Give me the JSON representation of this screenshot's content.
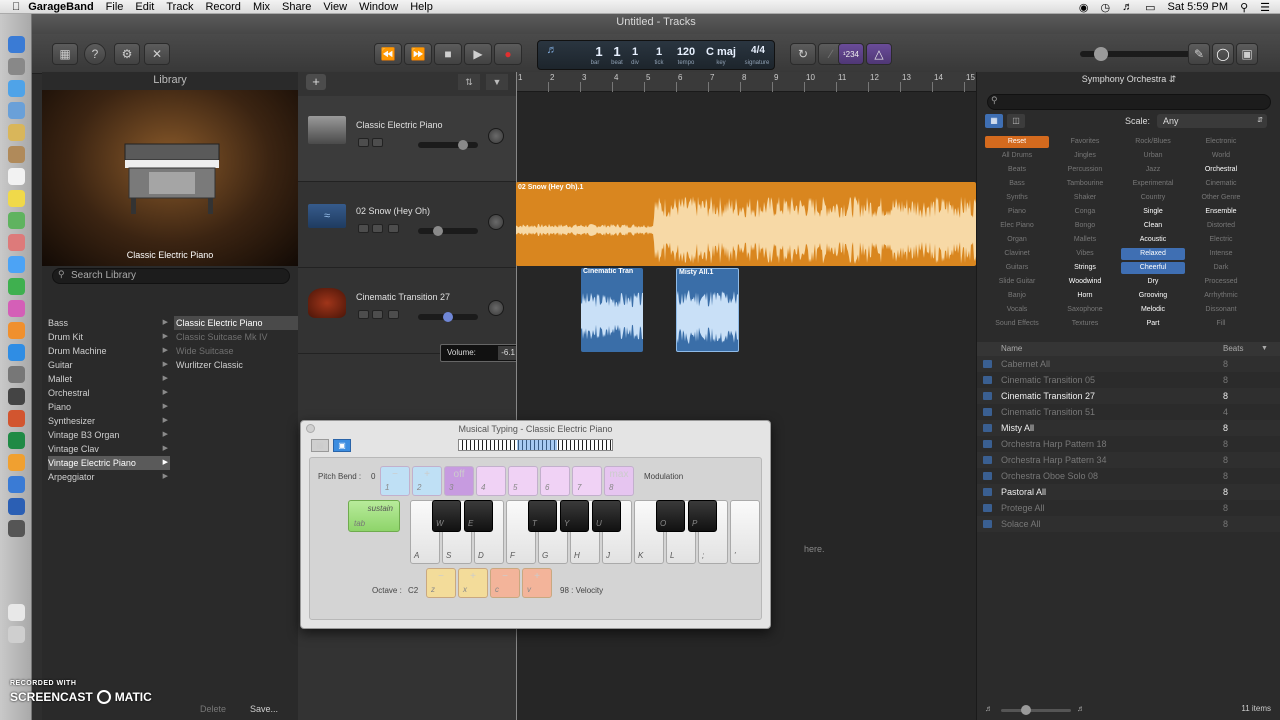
{
  "menubar": {
    "apple_icon": "apple-icon",
    "app_name": "GarageBand",
    "items": [
      "File",
      "Edit",
      "Track",
      "Record",
      "Mix",
      "Share",
      "View",
      "Window",
      "Help"
    ],
    "clock": "Sat 5:59 PM"
  },
  "window": {
    "title": "Untitled - Tracks"
  },
  "lcd": {
    "bar": "1",
    "beat": "1",
    "div": "1",
    "tick": "1",
    "tempo": "120",
    "key": "C maj",
    "signature": "4/4",
    "labels": {
      "bar": "bar",
      "beat": "beat",
      "div": "div",
      "tick": "tick",
      "tempo": "tempo",
      "key": "key",
      "signature": "signature"
    }
  },
  "toolbar": {
    "count_in": "¹234"
  },
  "library": {
    "title": "Library",
    "preview_caption": "Classic Electric Piano",
    "search_placeholder": "Search Library",
    "categories": [
      "Bass",
      "Drum Kit",
      "Drum Machine",
      "Guitar",
      "Mallet",
      "Orchestral",
      "Piano",
      "Synthesizer",
      "Vintage B3 Organ",
      "Vintage Clav",
      "Vintage Electric Piano",
      "Arpeggiator"
    ],
    "selected_category": "Vintage Electric Piano",
    "patches": [
      "Classic Electric Piano",
      "Classic Suitcase Mk IV",
      "Wide Suitcase",
      "Wurlitzer Classic"
    ],
    "delete_label": "Delete",
    "save_label": "Save..."
  },
  "tracks": [
    {
      "name": "Classic Electric Piano",
      "volume": 0.8
    },
    {
      "name": "02 Snow (Hey Oh)",
      "volume": 0.35
    },
    {
      "name": "Cinematic Transition 27",
      "volume": 0.5
    }
  ],
  "volume_tooltip": {
    "label": "Volume:",
    "value": "-6.1 dB"
  },
  "ruler": {
    "bars": [
      "1",
      "2",
      "3",
      "4",
      "5",
      "6",
      "7",
      "8",
      "9",
      "10",
      "11",
      "12",
      "13",
      "14",
      "15"
    ]
  },
  "regions": [
    {
      "title": "02 Snow (Hey Oh).1",
      "color": "#e59a2e"
    },
    {
      "title": "Cinematic Tran",
      "color": "#5c93c9"
    },
    {
      "title": "Misty All.1",
      "color": "#5c93c9"
    }
  ],
  "empty_hint_fragment": "here.",
  "loops": {
    "title": "Symphony Orchestra",
    "scale_label": "Scale:",
    "scale_value": "Any",
    "keywords": [
      [
        "Reset",
        "Favorites",
        "Rock/Blues",
        "Electronic"
      ],
      [
        "All Drums",
        "Jingles",
        "Urban",
        "World"
      ],
      [
        "Beats",
        "Percussion",
        "Jazz",
        "Orchestral"
      ],
      [
        "Bass",
        "Tambourine",
        "Experimental",
        "Cinematic"
      ],
      [
        "Synths",
        "Shaker",
        "Country",
        "Other Genre"
      ],
      [
        "Piano",
        "Conga",
        "Single",
        "Ensemble"
      ],
      [
        "Elec Piano",
        "Bongo",
        "Clean",
        "Distorted"
      ],
      [
        "Organ",
        "Mallets",
        "Acoustic",
        "Electric"
      ],
      [
        "Clavinet",
        "Vibes",
        "Relaxed",
        "Intense"
      ],
      [
        "Guitars",
        "Strings",
        "Cheerful",
        "Dark"
      ],
      [
        "Slide Guitar",
        "Woodwind",
        "Dry",
        "Processed"
      ],
      [
        "Banjo",
        "Horn",
        "Grooving",
        "Arrhythmic"
      ],
      [
        "Vocals",
        "Saxophone",
        "Melodic",
        "Dissonant"
      ],
      [
        "Sound Effects",
        "Textures",
        "Part",
        "Fill"
      ]
    ],
    "active_keywords": [
      "Orchestral",
      "Single",
      "Ensemble",
      "Clean",
      "Acoustic",
      "Strings",
      "Woodwind",
      "Dry",
      "Horn",
      "Grooving",
      "Melodic",
      "Part"
    ],
    "selected_keywords": [
      "Relaxed",
      "Cheerful"
    ],
    "columns": {
      "name": "Name",
      "beats": "Beats"
    },
    "results": [
      {
        "name": "Cabernet All",
        "beats": "8",
        "bright": false
      },
      {
        "name": "Cinematic Transition 05",
        "beats": "8",
        "bright": false
      },
      {
        "name": "Cinematic Transition 27",
        "beats": "8",
        "bright": true
      },
      {
        "name": "Cinematic Transition 51",
        "beats": "4",
        "bright": false
      },
      {
        "name": "Misty All",
        "beats": "8",
        "bright": true
      },
      {
        "name": "Orchestra Harp Pattern 18",
        "beats": "8",
        "bright": false
      },
      {
        "name": "Orchestra Harp Pattern 34",
        "beats": "8",
        "bright": false
      },
      {
        "name": "Orchestra Oboe Solo 08",
        "beats": "8",
        "bright": false
      },
      {
        "name": "Pastoral All",
        "beats": "8",
        "bright": true
      },
      {
        "name": "Protege All",
        "beats": "8",
        "bright": false
      },
      {
        "name": "Solace All",
        "beats": "8",
        "bright": false
      }
    ],
    "count": "11 items"
  },
  "musical_typing": {
    "title": "Musical Typing - Classic Electric Piano",
    "pitch_bend_label": "Pitch Bend :",
    "pitch_bend_value": "0",
    "modulation_label": "Modulation",
    "sustain_label": "sustain",
    "sustain_key": "tab",
    "pads": [
      {
        "top": "−",
        "key": "1"
      },
      {
        "top": "+",
        "key": "2"
      },
      {
        "top": "off",
        "key": "3"
      },
      {
        "top": "",
        "key": "4"
      },
      {
        "top": "",
        "key": "5"
      },
      {
        "top": "",
        "key": "6"
      },
      {
        "top": "",
        "key": "7"
      },
      {
        "top": "max",
        "key": "8"
      }
    ],
    "white_keys": [
      "A",
      "S",
      "D",
      "F",
      "G",
      "H",
      "J",
      "K",
      "L",
      ";",
      "'"
    ],
    "black_keys": [
      "W",
      "E",
      "T",
      "Y",
      "U",
      "O",
      "P"
    ],
    "octave_label": "Octave :",
    "octave_value": "C2",
    "octave_keys": [
      {
        "top": "−",
        "key": "z"
      },
      {
        "top": "+",
        "key": "x"
      }
    ],
    "velocity_keys": [
      {
        "top": "−",
        "key": "c"
      },
      {
        "top": "+",
        "key": "v"
      }
    ],
    "velocity_text": "98 : Velocity"
  },
  "watermark": {
    "line1": "RECORDED WITH",
    "brand_left": "SCREENCAST",
    "brand_right": "MATIC"
  }
}
